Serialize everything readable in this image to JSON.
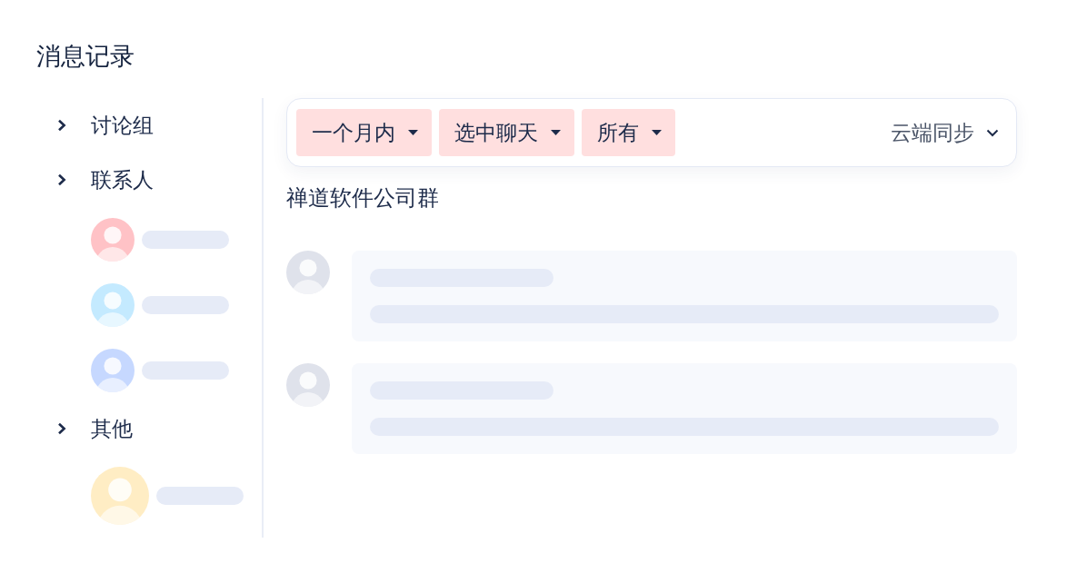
{
  "title": "消息记录",
  "sidebar": {
    "groups": [
      {
        "label": "讨论组"
      },
      {
        "label": "联系人",
        "children": [
          {
            "kind": "small",
            "color": "#ffc2c6"
          },
          {
            "kind": "small",
            "color": "#c4eaff"
          },
          {
            "kind": "small",
            "color": "#c6d8ff"
          }
        ]
      },
      {
        "label": "其他",
        "children": [
          {
            "kind": "large",
            "color": "#ffedc4"
          }
        ]
      }
    ]
  },
  "filter_bar": {
    "filters": [
      {
        "label": "一个月内"
      },
      {
        "label": "选中聊天"
      },
      {
        "label": "所有"
      }
    ],
    "sync": {
      "label": "云端同步"
    }
  },
  "conversation": {
    "title": "禅道软件公司群",
    "messages": [
      {
        "kind": "skeleton"
      },
      {
        "kind": "skeleton"
      }
    ]
  }
}
